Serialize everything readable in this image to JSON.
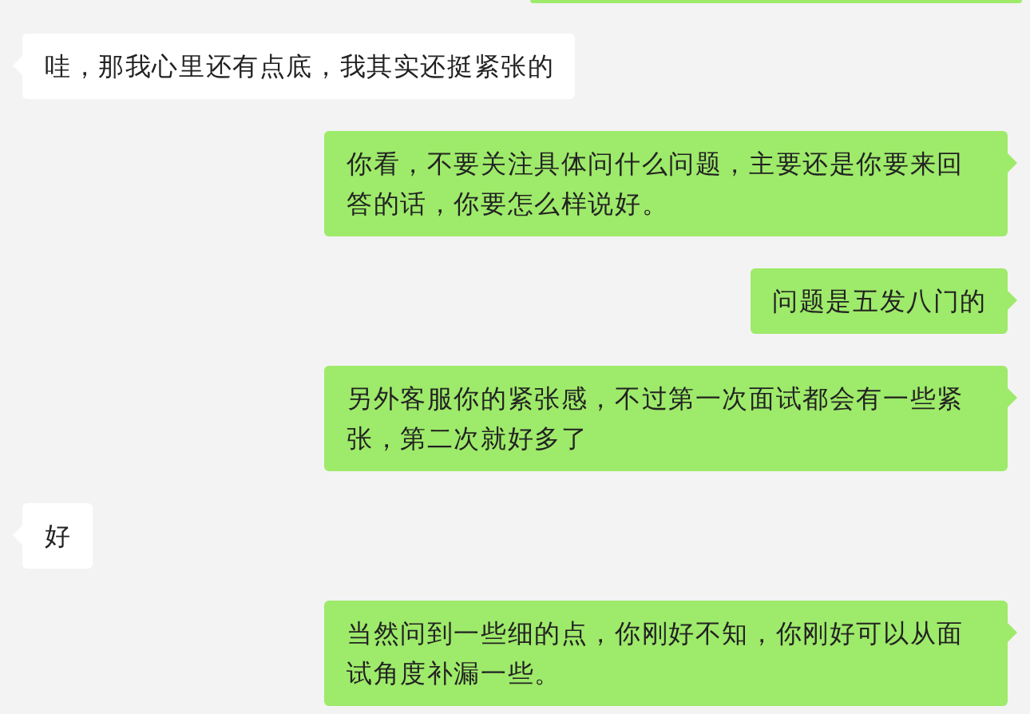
{
  "messages": [
    {
      "outgoing": true,
      "kind": "partial"
    },
    {
      "outgoing": false,
      "kind": "text",
      "text": "哇，那我心里还有点底，我其实还挺紧张的"
    },
    {
      "outgoing": true,
      "kind": "text",
      "text": "你看，不要关注具体问什么问题，主要还是你要来回答的话，你要怎么样说好。"
    },
    {
      "outgoing": true,
      "kind": "text",
      "text": "问题是五发八门的"
    },
    {
      "outgoing": true,
      "kind": "text",
      "text": "另外客服你的紧张感，不过第一次面试都会有一些紧张，第二次就好多了"
    },
    {
      "outgoing": false,
      "kind": "text",
      "text": "好"
    },
    {
      "outgoing": true,
      "kind": "text",
      "text": "当然问到一些细的点，你刚好不知，你刚好可以从面试角度补漏一些。"
    }
  ]
}
